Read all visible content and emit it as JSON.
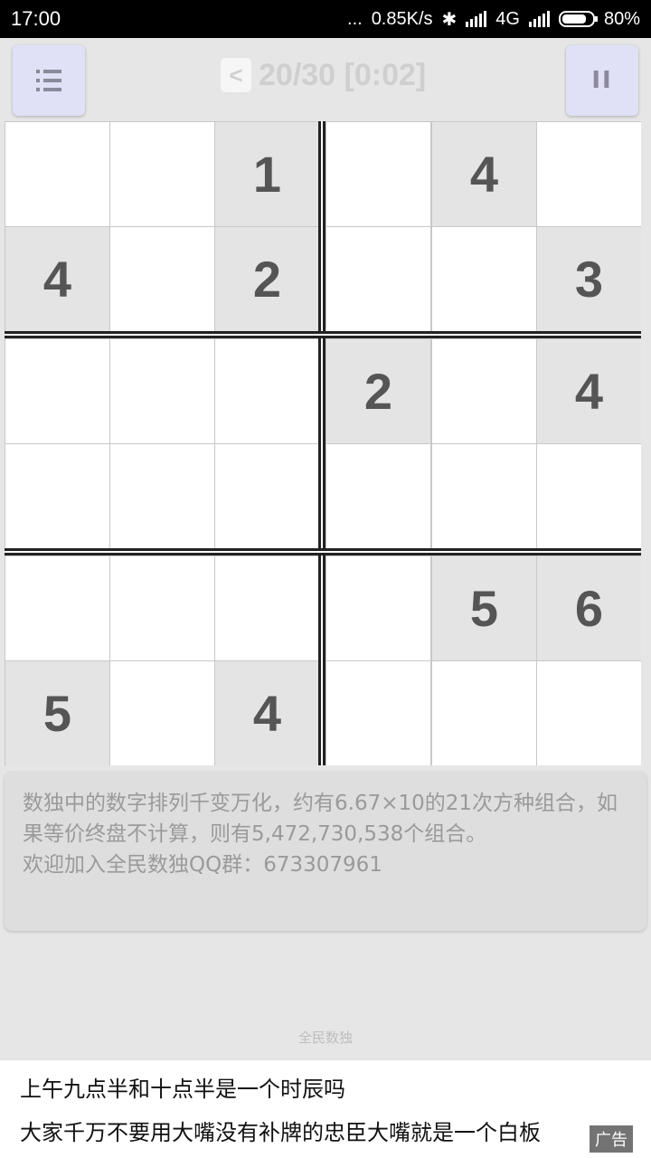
{
  "status_bar": {
    "time": "17:00",
    "dots": "...",
    "speed": "0.85K/s",
    "network": "4G",
    "battery": "80%",
    "battery_level": 0.8
  },
  "toolbar": {
    "prev_label": "<",
    "progress": "20/30 [0:02]",
    "pause_label": "II"
  },
  "board": {
    "rows": 6,
    "cols": 6,
    "cells": [
      [
        "",
        "",
        "1",
        "",
        "4",
        ""
      ],
      [
        "4",
        "",
        "2",
        "",
        "",
        "3"
      ],
      [
        "",
        "",
        "",
        "2",
        "",
        "4"
      ],
      [
        "",
        "",
        "",
        "",
        "",
        ""
      ],
      [
        "",
        "",
        "",
        "",
        "5",
        "6"
      ],
      [
        "5",
        "",
        "4",
        "",
        "",
        ""
      ]
    ]
  },
  "tip": {
    "line1": "数独中的数字排列千变万化，约有6.67×10的21次方种组合，如果等价终盘不计算，则有5,472,730,538个组合。",
    "line2": "欢迎加入全民数独QQ群：673307961"
  },
  "footer": {
    "app_name": "全民数独"
  },
  "ad": {
    "line1": "上午九点半和十点半是一个时辰吗",
    "line2": "大家千万不要用大嘴没有补牌的忠臣大嘴就是一个白板",
    "tag": "广告"
  },
  "colors": {
    "given_cell": "#e4e4e4",
    "button_bg": "#e0e0f6",
    "digit": "#555555"
  }
}
